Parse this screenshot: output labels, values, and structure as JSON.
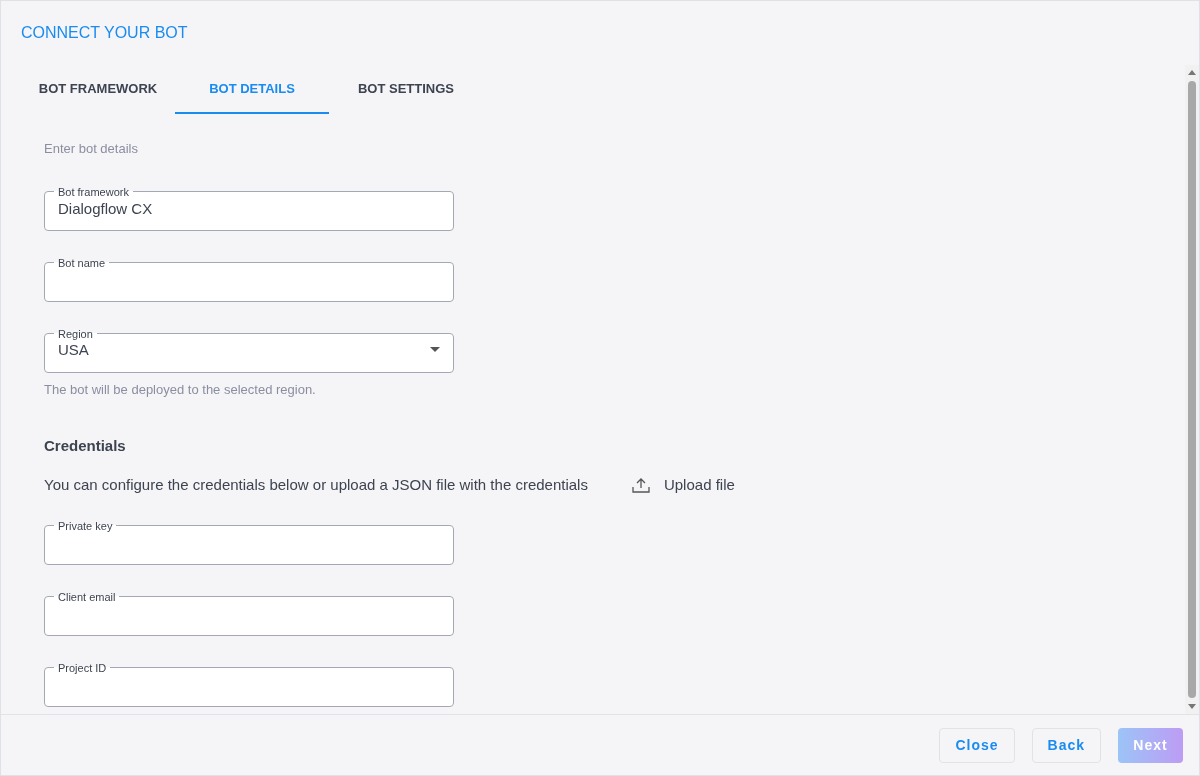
{
  "dialog": {
    "title": "CONNECT YOUR BOT"
  },
  "tabs": [
    {
      "label": "BOT FRAMEWORK",
      "selected": false
    },
    {
      "label": "BOT DETAILS",
      "selected": true
    },
    {
      "label": "BOT SETTINGS",
      "selected": false
    }
  ],
  "intro": "Enter bot details",
  "fields": [
    {
      "kind": "text",
      "label": "Bot framework",
      "value": "Dialogflow CX"
    },
    {
      "kind": "text",
      "label": "Bot name"
    },
    {
      "kind": "select",
      "label": "Region",
      "value": "USA",
      "help": "The bot will be deployed to the selected region."
    }
  ],
  "credentials": {
    "heading": "Credentials",
    "text": "You can configure the credentials below or upload a JSON file with the credentials",
    "upload": "Upload file",
    "fields": [
      {
        "kind": "text",
        "label": "Private key"
      },
      {
        "kind": "text",
        "label": "Client email"
      },
      {
        "kind": "text",
        "label": "Project ID"
      }
    ]
  },
  "buttons": [
    {
      "label": "Close",
      "disabled": false,
      "kind": "secondary"
    },
    {
      "label": "Back",
      "disabled": false,
      "kind": "secondary"
    },
    {
      "label": "Next",
      "disabled": true,
      "kind": "primary"
    }
  ]
}
